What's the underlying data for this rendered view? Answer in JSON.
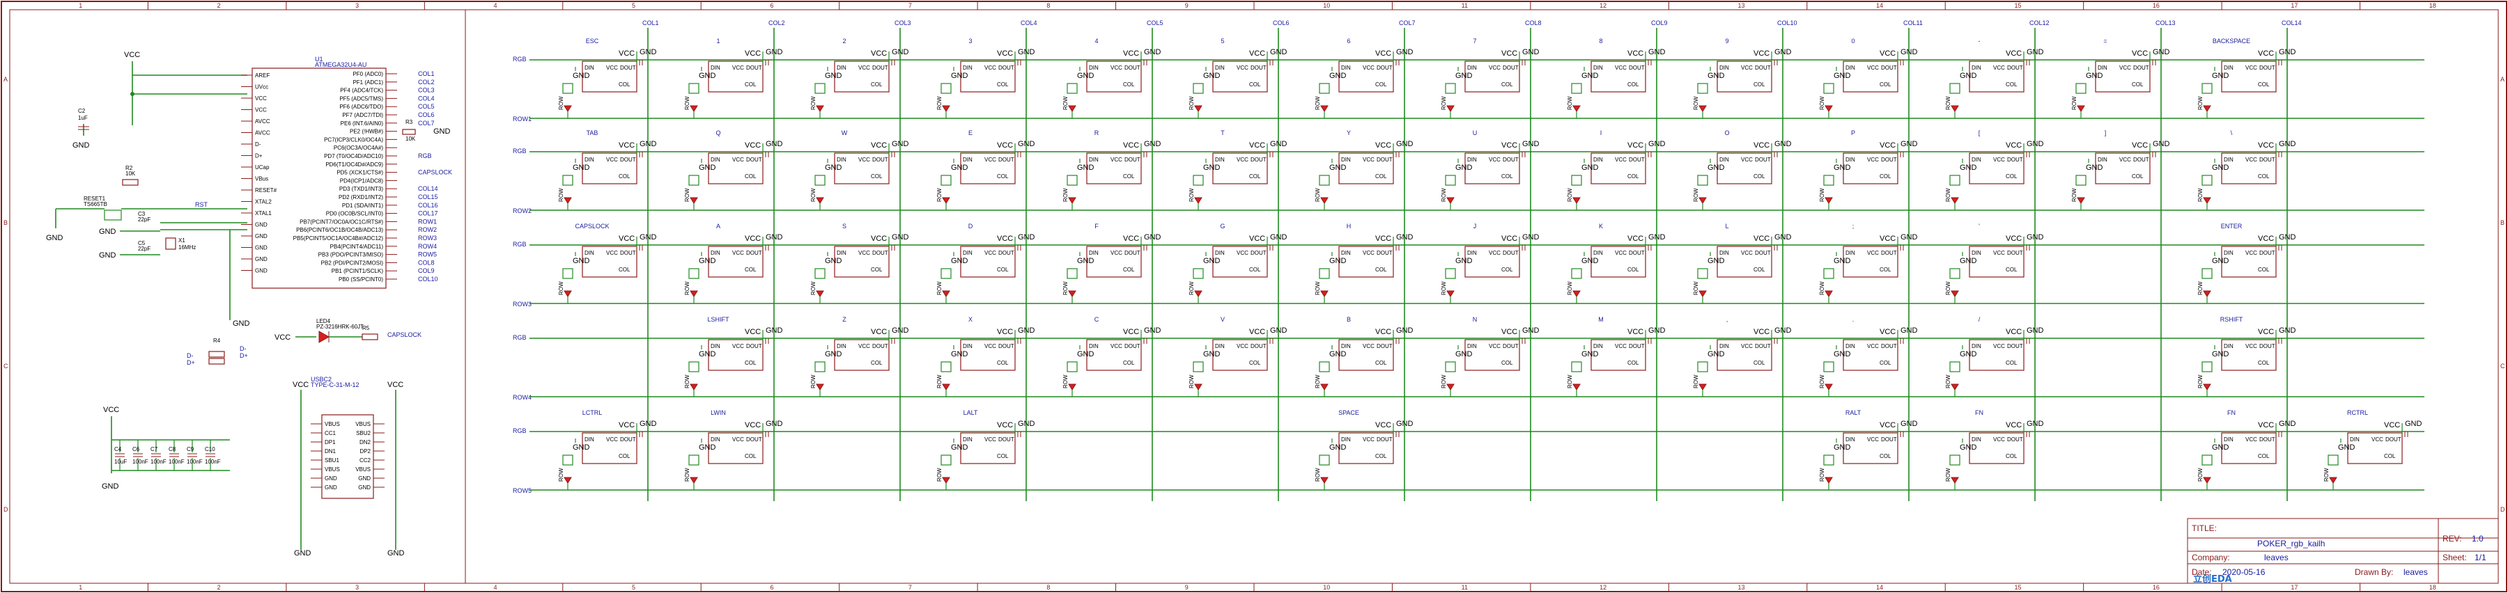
{
  "sheet": {
    "zones_top": [
      "1",
      "2",
      "3",
      "4",
      "5",
      "6",
      "7",
      "8",
      "9",
      "10",
      "11",
      "12",
      "13",
      "14",
      "15",
      "16",
      "17",
      "18"
    ],
    "zones_side": [
      "A",
      "B",
      "C",
      "D"
    ]
  },
  "mcu": {
    "ref": "U1",
    "part": "ATMEGA32U4-AU",
    "left_pins": [
      "AREF",
      "UVcc",
      "VCC",
      "VCC",
      "AVCC",
      "AVCC",
      "D-",
      "D+",
      "UCap",
      "VBus",
      "RESET#",
      "XTAL2",
      "XTAL1",
      "GND",
      "GND",
      "GND",
      "GND",
      "GND"
    ],
    "right_pins": [
      "PF0 (ADC0)",
      "PF1 (ADC1)",
      "PF4 (ADC4/TCK)",
      "PF5 (ADC5/TMS)",
      "PF6 (ADC6/TDO)",
      "PF7 (ADC7/TDI)",
      "PE6 (INT.6/AIN0)",
      "PE2 (!HWB#)",
      "PC7(ICP3/CLK0/OC4A)",
      "PC6(OC3A/OC4A#)",
      "PD7 (T0/OC4D/ADC10)",
      "PD6(T1/OC4D#/ADC9)",
      "PD5 (XCK1/CTS#)",
      "PD4(ICP1/ADC8)",
      "PD3 (TXD1/INT3)",
      "PD2 (RXD1/INT2)",
      "PD1 (SDA/INT1)",
      "PD0 (OC0B/SCL/INT0)",
      "PB7(PCINT7/OC0A/OC1C/RTS#)",
      "PB6(PCINT6/OC1B/OC4B/ADC13)",
      "PB5(PCINT5/OC1A/OC4B#/ADC12)",
      "PB4(PCINT4/ADC11)",
      "PB3 (PDO/PCINT3/MISO)",
      "PB2 (PDI/PCINT2/MOSI)",
      "PB1 (PCINT1/SCLK)",
      "PB0 (SS/PCINT0)"
    ],
    "right_nets": [
      "COL1",
      "COL2",
      "COL3",
      "COL4",
      "COL5",
      "COL6",
      "COL7",
      "",
      "",
      "",
      "RGB",
      "",
      "CAPSLOCK",
      "",
      "COL14",
      "COL15",
      "COL16",
      "COL17",
      "ROW1",
      "ROW2",
      "ROW3",
      "ROW4",
      "ROW5",
      "COL8",
      "COL9",
      "COL10"
    ]
  },
  "left_misc": {
    "vcc": "VCC",
    "gnd": "GND",
    "c2": "C2",
    "c2_val": "1uF",
    "r2": "R2",
    "r2_val": "10K",
    "reset": "RESET1",
    "reset_part": "TS665TB",
    "rst_net": "RST",
    "c3": "C3",
    "c3_val": "22pF",
    "c5": "C5",
    "c5_val": "22pF",
    "x1": "X1",
    "x1_val": "16MHz",
    "r3": "R3",
    "r3_val": "10K",
    "led_ref": "LED4",
    "led_part": "PZ-3216HRK-60JT",
    "r5": "R5",
    "capslock": "CAPSLOCK",
    "r4": "R4",
    "dm": "D-",
    "dp": "D+",
    "usb_ref": "USBC2",
    "usb_part": "TYPE-C-31-M-12",
    "usb_left": [
      "VBUS",
      "CC1",
      "DP1",
      "DN1",
      "SBU1",
      "VBUS",
      "GND",
      "GND"
    ],
    "usb_right": [
      "VBUS",
      "SBU2",
      "DN2",
      "DP2",
      "CC2",
      "VBUS",
      "GND",
      "GND"
    ],
    "caps": [
      "C4",
      "C6",
      "C7",
      "C8",
      "C9",
      "C10"
    ],
    "caps_val": [
      "10uF",
      "100nF",
      "100nF",
      "100nF",
      "100nF",
      "100nF"
    ]
  },
  "matrix": {
    "col_nets": [
      "COL1",
      "COL2",
      "COL3",
      "COL4",
      "COL5",
      "COL6",
      "COL7",
      "COL8",
      "COL9",
      "COL10",
      "COL11",
      "COL12",
      "COL13",
      "COL14"
    ],
    "row_nets": [
      "ROW1",
      "ROW2",
      "ROW3",
      "ROW4",
      "ROW5"
    ],
    "rgb_net": "RGB",
    "rows": [
      [
        "ESC",
        "1",
        "2",
        "3",
        "4",
        "5",
        "6",
        "7",
        "8",
        "9",
        "0",
        "-",
        "=",
        "BACKSPACE"
      ],
      [
        "TAB",
        "Q",
        "W",
        "E",
        "R",
        "T",
        "Y",
        "U",
        "I",
        "O",
        "P",
        "[",
        "]",
        "\\"
      ],
      [
        "CAPSLOCK",
        "A",
        "S",
        "D",
        "F",
        "G",
        "H",
        "J",
        "K",
        "L",
        ";",
        "'",
        "ENTER"
      ],
      [
        "LSHIFT",
        "Z",
        "X",
        "C",
        "V",
        "B",
        "N",
        "M",
        ",",
        ".",
        "/",
        "RSHIFT"
      ],
      [
        "LCTRL",
        "LWIN",
        "LALT",
        "SPACE",
        "RALT",
        "FN",
        "FN",
        "RCTRL"
      ]
    ],
    "cell_pins": {
      "din": "DIN",
      "dout": "DOUT",
      "vcc": "VCC",
      "gnd": "GND",
      "col": "COL",
      "row": "ROW"
    }
  },
  "title_block": {
    "title_label": "TITLE:",
    "title": "POKER_rgb_kailh",
    "rev_label": "REV:",
    "rev": "1.0",
    "company_label": "Company:",
    "company": "leaves",
    "sheet_label": "Sheet:",
    "sheet": "1/1",
    "date_label": "Date:",
    "date": "2020-05-16",
    "drawn_label": "Drawn By:",
    "drawn": "leaves",
    "logo": "立创EDA"
  }
}
